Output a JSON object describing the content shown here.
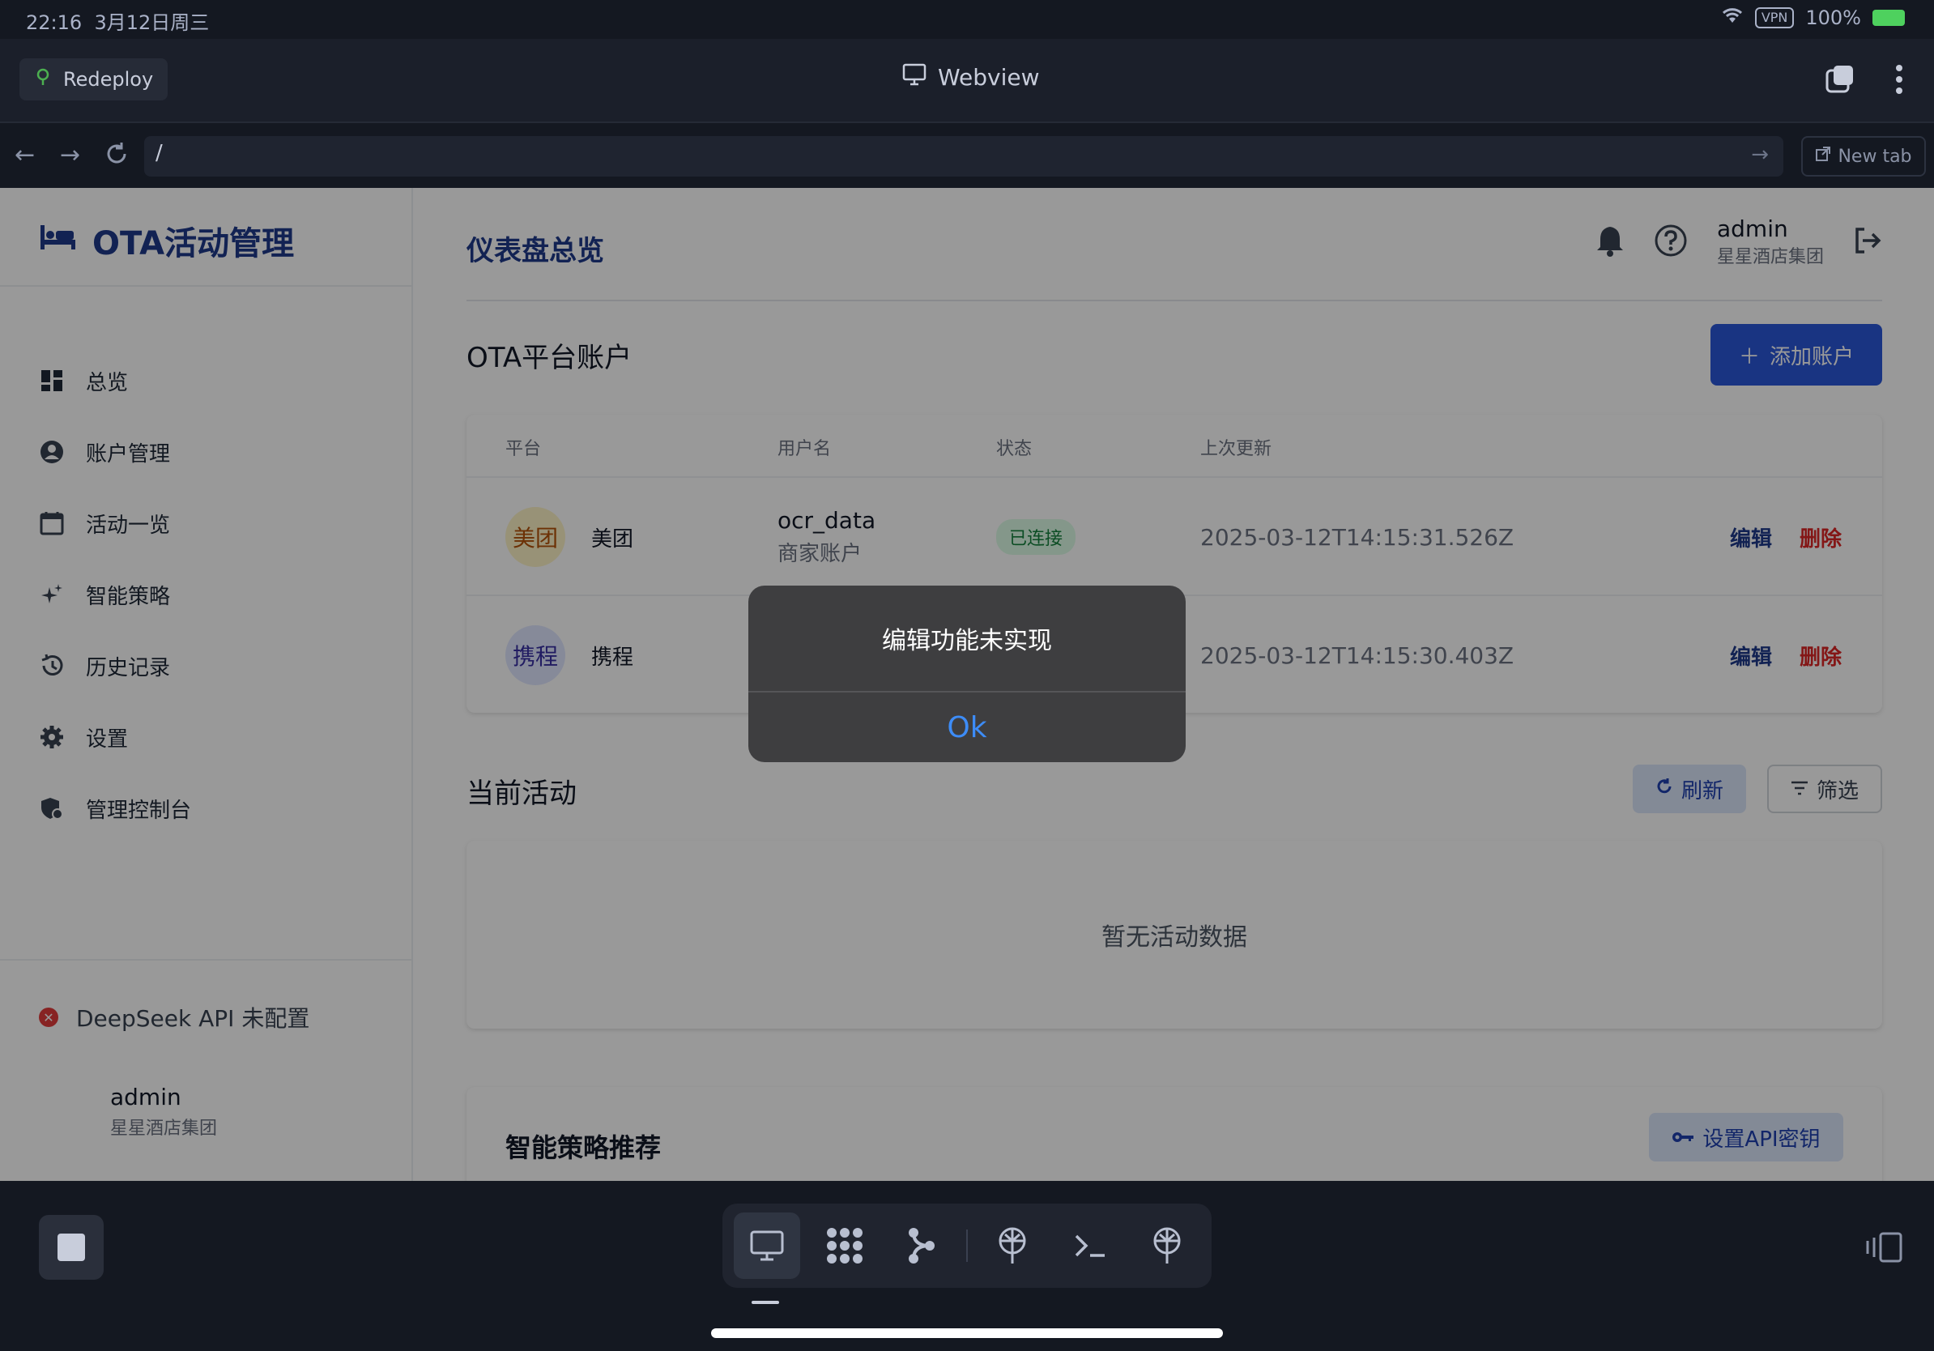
{
  "status_bar": {
    "time": "22:16",
    "date": "3月12日周三",
    "vpn": "VPN",
    "battery": "100%"
  },
  "top_bar": {
    "redeploy_label": "Redeploy",
    "title": "Webview"
  },
  "url_bar": {
    "url": "/",
    "new_tab_label": "New tab"
  },
  "sidebar": {
    "brand": "OTA活动管理",
    "items": [
      {
        "label": "总览",
        "icon": "dashboard-icon"
      },
      {
        "label": "账户管理",
        "icon": "account-circle-icon"
      },
      {
        "label": "活动一览",
        "icon": "calendar-icon"
      },
      {
        "label": "智能策略",
        "icon": "sparkle-icon"
      },
      {
        "label": "历史记录",
        "icon": "history-icon"
      },
      {
        "label": "设置",
        "icon": "gear-icon"
      },
      {
        "label": "管理控制台",
        "icon": "admin-shield-icon"
      }
    ],
    "api_status": "DeepSeek API 未配置",
    "user": {
      "name": "admin",
      "org": "星星酒店集团"
    }
  },
  "header": {
    "title": "仪表盘总览",
    "user": {
      "name": "admin",
      "org": "星星酒店集团"
    }
  },
  "accounts": {
    "title": "OTA平台账户",
    "add_button": "添加账户",
    "columns": [
      "平台",
      "用户名",
      "状态",
      "上次更新"
    ],
    "rows": [
      {
        "avatar": "美团",
        "platform": "美团",
        "username": "ocr_data",
        "account_type": "商家账户",
        "status": "已连接",
        "updated": "2025-03-12T14:15:31.526Z",
        "edit": "编辑",
        "delete": "删除"
      },
      {
        "avatar": "携程",
        "platform": "携程",
        "updated": "2025-03-12T14:15:30.403Z",
        "edit": "编辑",
        "delete": "删除"
      }
    ]
  },
  "activities": {
    "title": "当前活动",
    "refresh": "刷新",
    "filter": "筛选",
    "empty": "暂无活动数据"
  },
  "strategy": {
    "title": "智能策略推荐",
    "set_api": "设置API密钥"
  },
  "dialog": {
    "message": "编辑功能未实现",
    "ok": "Ok"
  },
  "colors": {
    "primary": "#2b57d9",
    "brand": "#1e3a8a",
    "danger": "#dc2626",
    "success": "#15803d",
    "dialog_bg": "#3e3e40",
    "dialog_ok": "#3d8cf7"
  }
}
